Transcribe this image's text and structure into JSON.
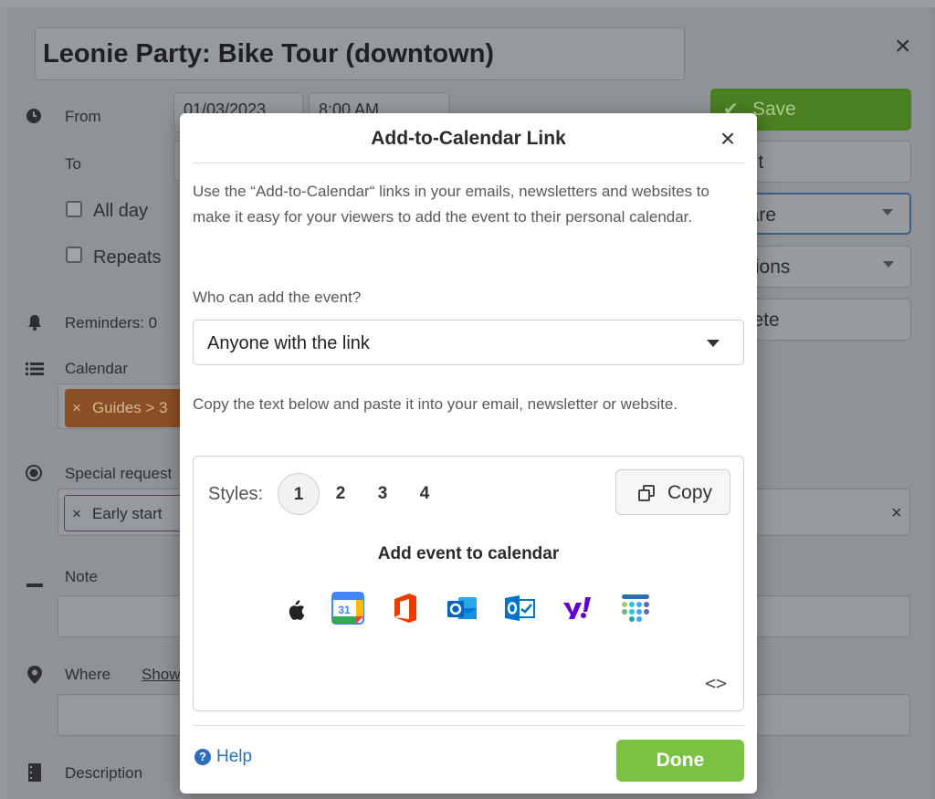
{
  "background": {
    "event_title": "Leonie Party: Bike Tour (downtown)",
    "close_glyph": "×",
    "from_label": "From",
    "from_date": "01/03/2023",
    "from_time": "8:00 AM",
    "to_label": "To",
    "all_day_label": "All day",
    "repeats_label": "Repeats",
    "reminders_label": "Reminders: 0",
    "calendar_label": "Calendar",
    "calendar_chip": "Guides > 3",
    "special_requests_label": "Special request",
    "special_chip": "Early start",
    "note_label": "Note",
    "where_label": "Where",
    "where_link": "Show",
    "description_label": "Description",
    "chip_remove_glyph": "×",
    "buttons": {
      "save": "Save",
      "print": "Print",
      "share": "Share",
      "options": "Options",
      "delete": "Delete"
    }
  },
  "modal": {
    "title": "Add-to-Calendar Link",
    "close_glyph": "×",
    "intro": "Use the “Add-to-Calendar“ links in your emails, newsletters and websites to make it easy for your viewers to add the event to their personal calendar.",
    "who_label": "Who can add the event?",
    "who_value": "Anyone with the link",
    "copy_hint": "Copy the text below and paste it into your email, newsletter or website.",
    "styles_label": "Styles:",
    "style_options": [
      "1",
      "2",
      "3",
      "4"
    ],
    "active_style": "1",
    "copy_label": "Copy",
    "preview_title": "Add event to calendar",
    "calendar_icons": [
      "apple-icon",
      "google-calendar-icon",
      "office365-icon",
      "outlook-icon",
      "outlook-com-icon",
      "yahoo-icon",
      "teamup-icon"
    ],
    "google_day": "31",
    "code_toggle": "<>",
    "help_label": "Help",
    "done_label": "Done"
  },
  "colors": {
    "done_green": "#7cc242",
    "help_blue": "#2f6db8",
    "save_green": "#4a7f22",
    "chip_orange": "#8a4f24"
  }
}
